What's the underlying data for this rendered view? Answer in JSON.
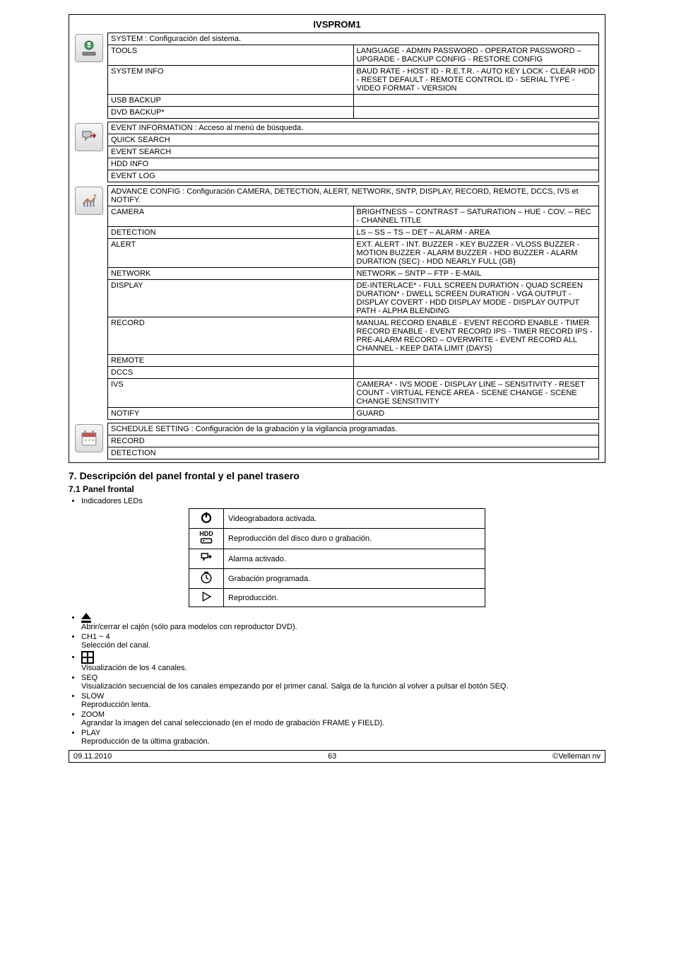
{
  "title": "IVSPROM1",
  "system": {
    "header": "SYSTEM : Configuración del sistema.",
    "rows": [
      {
        "l": "TOOLS",
        "r": "LANGUAGE - ADMIN PASSWORD - OPERATOR PASSWORD – UPGRADE - BACKUP CONFIG - RESTORE CONFIG"
      },
      {
        "l": "SYSTEM INFO",
        "r": "BAUD RATE - HOST ID - R.E.T.R. - AUTO KEY LOCK - CLEAR HDD - RESET DEFAULT - REMOTE CONTROL ID - SERIAL TYPE - VIDEO FORMAT - VERSION"
      },
      {
        "l": "USB BACKUP",
        "r": ""
      },
      {
        "l": "DVD BACKUP*",
        "r": ""
      }
    ]
  },
  "event": {
    "header": "EVENT INFORMATION : Acceso al menú de búsqueda.",
    "lines": [
      "QUICK SEARCH",
      "EVENT SEARCH",
      "HDD INFO",
      "EVENT LOG"
    ]
  },
  "advance": {
    "header": "ADVANCE CONFIG : Configuración CAMERA, DETECTION, ALERT, NETWORK, SNTP, DISPLAY, RECORD, REMOTE, DCCS, IVS et NOTIFY.",
    "rows": [
      {
        "l": "CAMERA",
        "r": "BRIGHTNESS – CONTRAST – SATURATION – HUE - COV. – REC - CHANNEL TITLE"
      },
      {
        "l": "DETECTION",
        "r": "LS – SS – TS – DET – ALARM - AREA"
      },
      {
        "l": "ALERT",
        "r": "EXT. ALERT - INT. BUZZER - KEY BUZZER - VLOSS BUZZER - MOTION BUZZER - ALARM BUZZER - HDD BUZZER - ALARM DURATION (SEC) - HDD NEARLY FULL (GB)"
      },
      {
        "l": "NETWORK",
        "r": "NETWORK – SNTP – FTP - E-MAIL"
      },
      {
        "l": "DISPLAY",
        "r": "DE-INTERLACE* - FULL SCREEN DURATION - QUAD SCREEN DURATION* - DWELL SCREEN DURATION - VGA OUTPUT - DISPLAY COVERT - HDD DISPLAY MODE - DISPLAY OUTPUT PATH - ALPHA BLENDING"
      },
      {
        "l": "RECORD",
        "r": "MANUAL RECORD ENABLE - EVENT RECORD ENABLE - TIMER RECORD ENABLE - EVENT RECORD IPS - TIMER RECORD IPS - PRE-ALARM RECORD – OVERWRITE - EVENT RECORD ALL CHANNEL - KEEP DATA LIMIT (DAYS)"
      },
      {
        "l": "REMOTE",
        "r": ""
      },
      {
        "l": "DCCS",
        "r": ""
      },
      {
        "l": "IVS",
        "r": "CAMERA* - IVS MODE - DISPLAY LINE – SENSITIVITY - RESET COUNT - VIRTUAL FENCE AREA - SCENE CHANGE - SCENE CHANGE SENSITIVITY"
      },
      {
        "l": "NOTIFY",
        "r": "GUARD"
      }
    ]
  },
  "schedule": {
    "header": "SCHEDULE SETTING : Configuración de la grabación y la vigilancia programadas.",
    "rows": [
      "RECORD",
      "DETECTION"
    ]
  },
  "sect7": "7.  Descripción del panel frontal y el panel trasero",
  "sect71": "7.1 Panel frontal",
  "ledintro": "Indicadores LEDs",
  "leds": [
    {
      "t": "Videograbadora activada."
    },
    {
      "t": "Reproducción del disco duro o grabación."
    },
    {
      "t": "Alarma activado."
    },
    {
      "t": "Grabación programada."
    },
    {
      "t": "Reproducción."
    }
  ],
  "bullets": [
    {
      "h": "",
      "t": "Abrir/cerrar el cajón (sólo para modelos con reproductor DVD)."
    },
    {
      "h": "CH1 ~ 4",
      "t": "Selección del canal."
    },
    {
      "h": "",
      "t": "Visualización de los 4 canales."
    },
    {
      "h": "SEQ",
      "t": "Visualización secuencial de los canales empezando por el primer canal. Salga de la función al volver a pulsar el botón SEQ."
    },
    {
      "h": "SLOW",
      "t": "Reproducción lenta."
    },
    {
      "h": "ZOOM",
      "t": "Agrandar la imagen del canal seleccionado (en el modo de grabación FRAME y FIELD)."
    },
    {
      "h": "PLAY",
      "t": "Reproducción de la última grabación."
    }
  ],
  "footer": {
    "left": "09.11.2010",
    "center": "63",
    "right": "©Velleman nv"
  }
}
